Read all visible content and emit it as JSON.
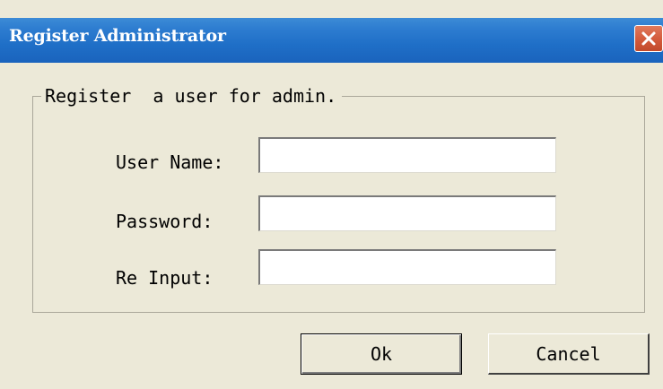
{
  "window": {
    "title": "Register Administrator",
    "close_icon": "close-icon"
  },
  "group": {
    "legend": "Register  a user for admin."
  },
  "fields": {
    "user_name_label": "User Name:",
    "user_name_value": "",
    "password_label": "Password:",
    "password_value": "",
    "reinput_label": "Re Input:",
    "reinput_value": ""
  },
  "buttons": {
    "ok_label": "Ok",
    "cancel_label": "Cancel"
  },
  "colors": {
    "titlebar": "#1f6fc7",
    "dialog_bg": "#ece9d8",
    "close_button": "#d35a3b"
  }
}
